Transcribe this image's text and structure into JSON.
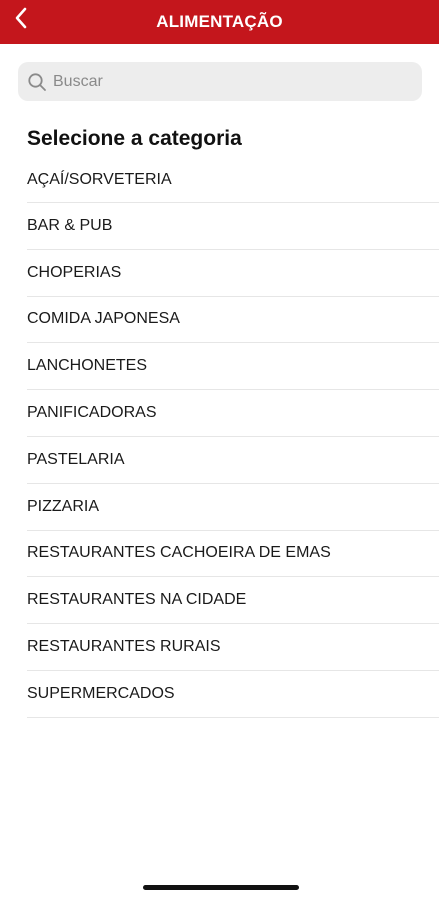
{
  "header": {
    "title": "ALIMENTAÇÃO",
    "back_icon": "chevron-left-icon",
    "background_color": "#c4161c"
  },
  "search": {
    "placeholder": "Buscar",
    "value": "",
    "icon": "search-icon"
  },
  "main": {
    "section_title": "Selecione a categoria",
    "categories": [
      "AÇAÍ/SORVETERIA",
      "BAR & PUB",
      "CHOPERIAS",
      "COMIDA JAPONESA",
      "LANCHONETES",
      "PANIFICADORAS",
      "PASTELARIA",
      "PIZZARIA",
      "RESTAURANTES CACHOEIRA DE EMAS",
      "RESTAURANTES NA CIDADE",
      "RESTAURANTES RURAIS",
      "SUPERMERCADOS"
    ]
  }
}
